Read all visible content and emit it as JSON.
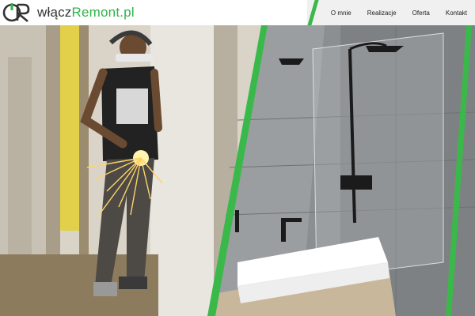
{
  "brand": {
    "name_part1": "włącz",
    "name_part2": "Remont.pl",
    "accent_color": "#3ab94a",
    "logo_icon": "power-plug-logo-icon"
  },
  "nav": {
    "items": [
      {
        "label": "O mnie"
      },
      {
        "label": "Realizacje"
      },
      {
        "label": "Oferta"
      },
      {
        "label": "Kontakt"
      }
    ]
  },
  "hero": {
    "left_image": "worker-grinding-photo",
    "right_image": "modern-bathroom-photo",
    "divider_color": "#3ab94a"
  }
}
